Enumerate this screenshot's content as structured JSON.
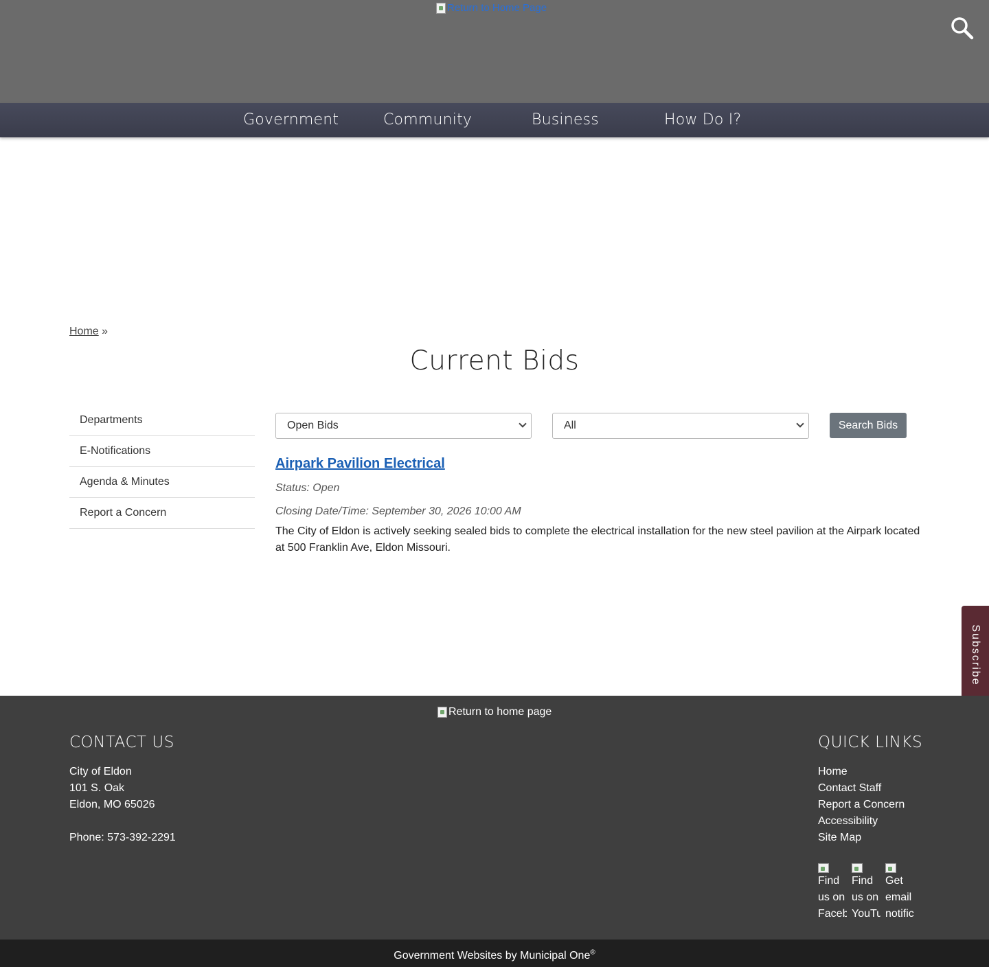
{
  "header": {
    "logo_alt": "Return to Home Page"
  },
  "nav": {
    "items": [
      {
        "label": "Government"
      },
      {
        "label": "Community"
      },
      {
        "label": "Business"
      },
      {
        "label": "How Do I?"
      }
    ]
  },
  "breadcrumb": {
    "home": "Home",
    "separator": "»"
  },
  "page": {
    "title": "Current Bids"
  },
  "sidebar": {
    "items": [
      {
        "label": "Departments"
      },
      {
        "label": "E-Notifications"
      },
      {
        "label": "Agenda & Minutes"
      },
      {
        "label": "Report a Concern"
      }
    ]
  },
  "filters": {
    "status_selected": "Open Bids",
    "category_selected": "All",
    "search_label": "Search Bids"
  },
  "bid": {
    "title": "Airpark Pavilion Electrical",
    "status": "Status: Open",
    "closing": "Closing Date/Time: September 30, 2026 10:00 AM",
    "description": "The City of Eldon is actively seeking sealed bids to complete the electrical installation for the new steel pavilion at the Airpark located at 500 Franklin Ave, Eldon Missouri."
  },
  "subscribe": {
    "label": "Subscribe"
  },
  "footer": {
    "logo_alt": "Return to home page",
    "contact": {
      "heading": "CONTACT US",
      "name": "City of Eldon",
      "street": "101 S. Oak",
      "city": "Eldon, MO 65026",
      "phone": "Phone: 573-392-2291"
    },
    "quick_links": {
      "heading": "QUICK LINKS",
      "items": [
        {
          "label": "Home"
        },
        {
          "label": "Contact Staff"
        },
        {
          "label": "Report a Concern"
        },
        {
          "label": "Accessibility"
        },
        {
          "label": "Site Map"
        }
      ]
    },
    "social": [
      {
        "alt": "Find us on Facebook"
      },
      {
        "alt": "Find us on YouTube"
      },
      {
        "alt": "Get email notifications"
      }
    ],
    "credit": "Government Websites by Municipal One",
    "credit_mark": "®"
  },
  "colors": {
    "header_bg": "#6b6b6b",
    "nav_bg": "#40424f",
    "link": "#1a5fb4",
    "footer_bg": "#3f3f3f",
    "bottom_bg": "#1f1f1f",
    "subscribe_bg": "#5a2a33",
    "button_bg": "#6b747c"
  }
}
